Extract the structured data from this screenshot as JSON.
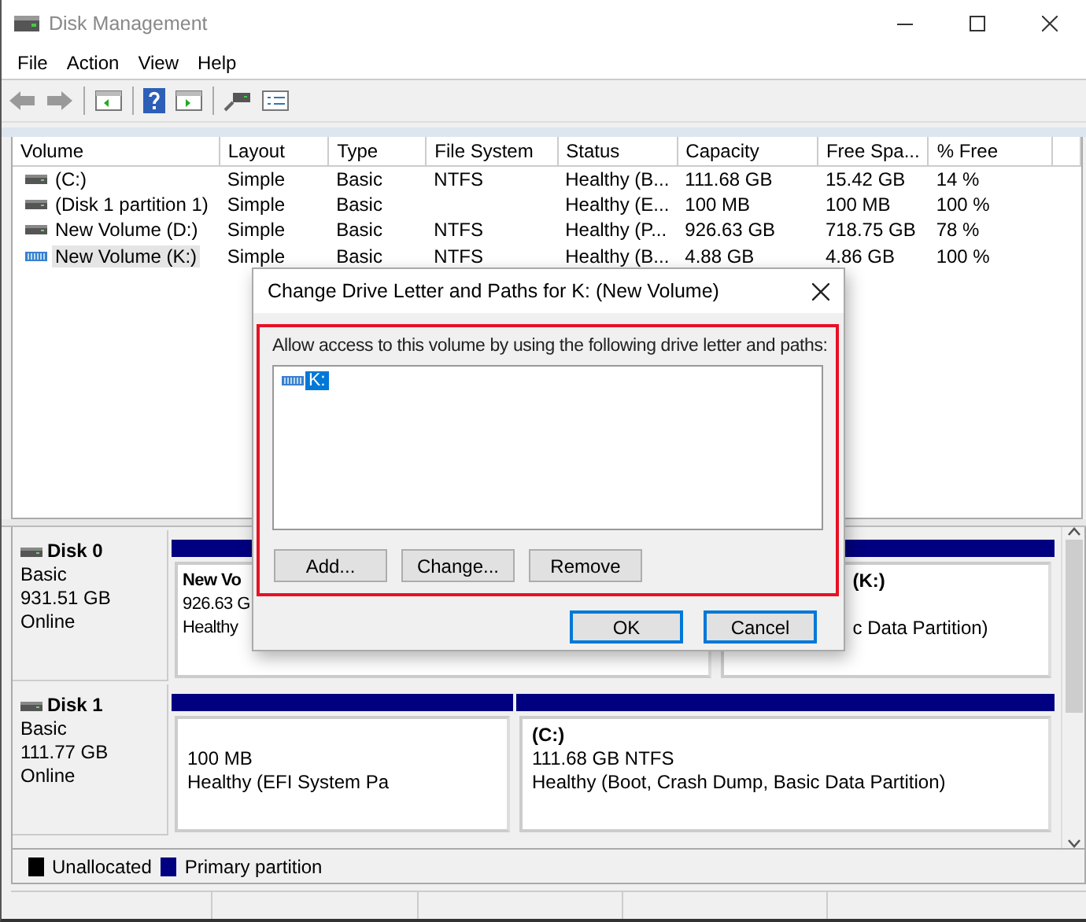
{
  "window": {
    "title": "Disk Management"
  },
  "menu": [
    "File",
    "Action",
    "View",
    "Help"
  ],
  "volumes": {
    "columns": [
      "Volume",
      "Layout",
      "Type",
      "File System",
      "Status",
      "Capacity",
      "Free Spa...",
      "% Free"
    ],
    "rows": [
      {
        "kind": "disk",
        "selected": false,
        "cells": [
          "(C:)",
          "Simple",
          "Basic",
          "NTFS",
          "Healthy (B...",
          "111.68 GB",
          "15.42 GB",
          "14 %"
        ]
      },
      {
        "kind": "disk",
        "selected": false,
        "cells": [
          "(Disk 1 partition 1)",
          "Simple",
          "Basic",
          "",
          "Healthy (E...",
          "100 MB",
          "100 MB",
          "100 %"
        ]
      },
      {
        "kind": "disk",
        "selected": false,
        "cells": [
          "New Volume (D:)",
          "Simple",
          "Basic",
          "NTFS",
          "Healthy (P...",
          "926.63 GB",
          "718.75 GB",
          "78 %"
        ]
      },
      {
        "kind": "striped",
        "selected": true,
        "cells": [
          "New Volume (K:)",
          "Simple",
          "Basic",
          "NTFS",
          "Healthy (B...",
          "4.88 GB",
          "4.86 GB",
          "100 %"
        ]
      }
    ]
  },
  "disks": [
    {
      "name": "Disk 0",
      "type": "Basic",
      "size": "931.51 GB",
      "status": "Online",
      "partitions": [
        {
          "name": "New Vo",
          "detail": "926.63 G",
          "status": "Healthy"
        },
        {
          "name": "(K:)",
          "status": "c Data Partition)"
        }
      ]
    },
    {
      "name": "Disk 1",
      "type": "Basic",
      "size": "111.77 GB",
      "status": "Online",
      "partitions": [
        {
          "detail": "100 MB",
          "status": "Healthy (EFI System Pa"
        },
        {
          "name": "(C:)",
          "detail": "111.68 GB NTFS",
          "status": "Healthy (Boot, Crash Dump, Basic Data Partition)"
        }
      ]
    }
  ],
  "legend": [
    {
      "label": "Unallocated",
      "color": "#000000"
    },
    {
      "label": "Primary partition",
      "color": "#000080"
    }
  ],
  "dialog": {
    "title": "Change Drive Letter and Paths for K: (New Volume)",
    "prompt": "Allow access to this volume by using the following drive letter and paths:",
    "paths": [
      {
        "label": "K:",
        "selected": true
      }
    ],
    "actions": [
      "Add...",
      "Change...",
      "Remove"
    ],
    "buttons": [
      "OK",
      "Cancel"
    ]
  }
}
